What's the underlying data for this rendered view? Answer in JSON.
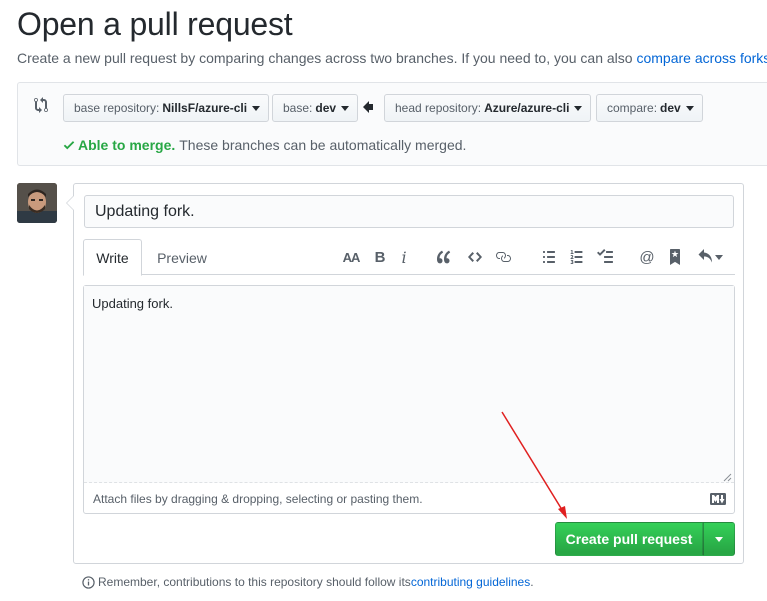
{
  "page": {
    "title": "Open a pull request",
    "subtitle_text": "Create a new pull request by comparing changes across two branches. If you need to, you can also ",
    "subtitle_link": "compare across forks",
    "subtitle_end": "."
  },
  "range": {
    "base_repo": {
      "label": "base repository:",
      "value": "NillsF/azure-cli"
    },
    "base": {
      "label": "base:",
      "value": "dev"
    },
    "head_repo": {
      "label": "head repository:",
      "value": "Azure/azure-cli"
    },
    "compare": {
      "label": "compare:",
      "value": "dev"
    },
    "merge_ok": "Able to merge.",
    "merge_msg": "These branches can be automatically merged."
  },
  "form": {
    "title_value": "Updating fork.",
    "tabs": {
      "write": "Write",
      "preview": "Preview"
    },
    "toolbar": {
      "heading": "AA",
      "bold": "B",
      "italic": "i",
      "mention": "@"
    },
    "body_value": "Updating fork.",
    "attach_text": "Attach files by dragging & dropping, selecting or pasting them.",
    "create_label": "Create pull request"
  },
  "footer": {
    "note_text": "Remember, contributions to this repository should follow its ",
    "note_link": "contributing guidelines",
    "note_end": "."
  },
  "colors": {
    "link": "#0366d6",
    "success": "#28a745",
    "annotation": "#e02020"
  }
}
